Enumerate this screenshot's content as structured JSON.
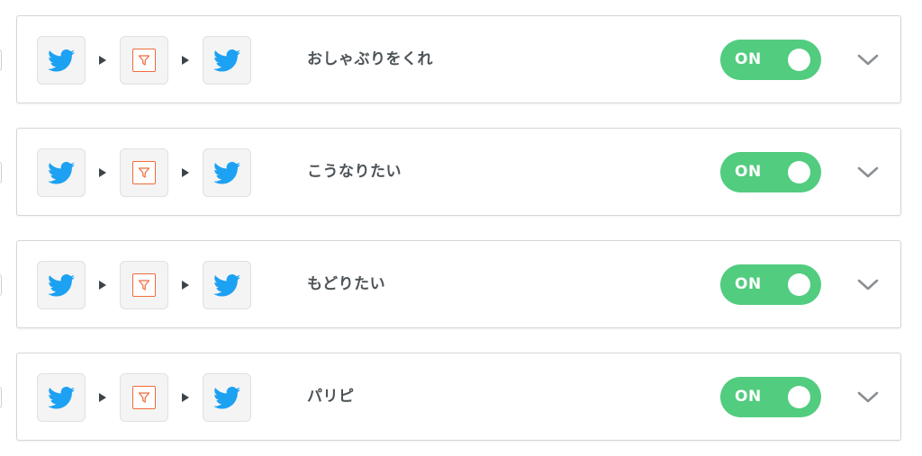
{
  "colors": {
    "twitter_blue": "#1da1f2",
    "filter_orange": "#ef6b3c",
    "toggle_green": "#52cc7f",
    "title_text": "#4d5458",
    "chevron_gray": "#8a8f93"
  },
  "flows": [
    {
      "name": "おしゃぶりをくれ",
      "trigger_icon": "twitter-bird-icon",
      "filter_icon": "filter-funnel-icon",
      "action_icon": "twitter-bird-icon",
      "toggle_label": "ON",
      "enabled": true
    },
    {
      "name": "こうなりたい",
      "trigger_icon": "twitter-bird-icon",
      "filter_icon": "filter-funnel-icon",
      "action_icon": "twitter-bird-icon",
      "toggle_label": "ON",
      "enabled": true
    },
    {
      "name": "もどりたい",
      "trigger_icon": "twitter-bird-icon",
      "filter_icon": "filter-funnel-icon",
      "action_icon": "twitter-bird-icon",
      "toggle_label": "ON",
      "enabled": true
    },
    {
      "name": "パリピ",
      "trigger_icon": "twitter-bird-icon",
      "filter_icon": "filter-funnel-icon",
      "action_icon": "twitter-bird-icon",
      "toggle_label": "ON",
      "enabled": true
    }
  ]
}
